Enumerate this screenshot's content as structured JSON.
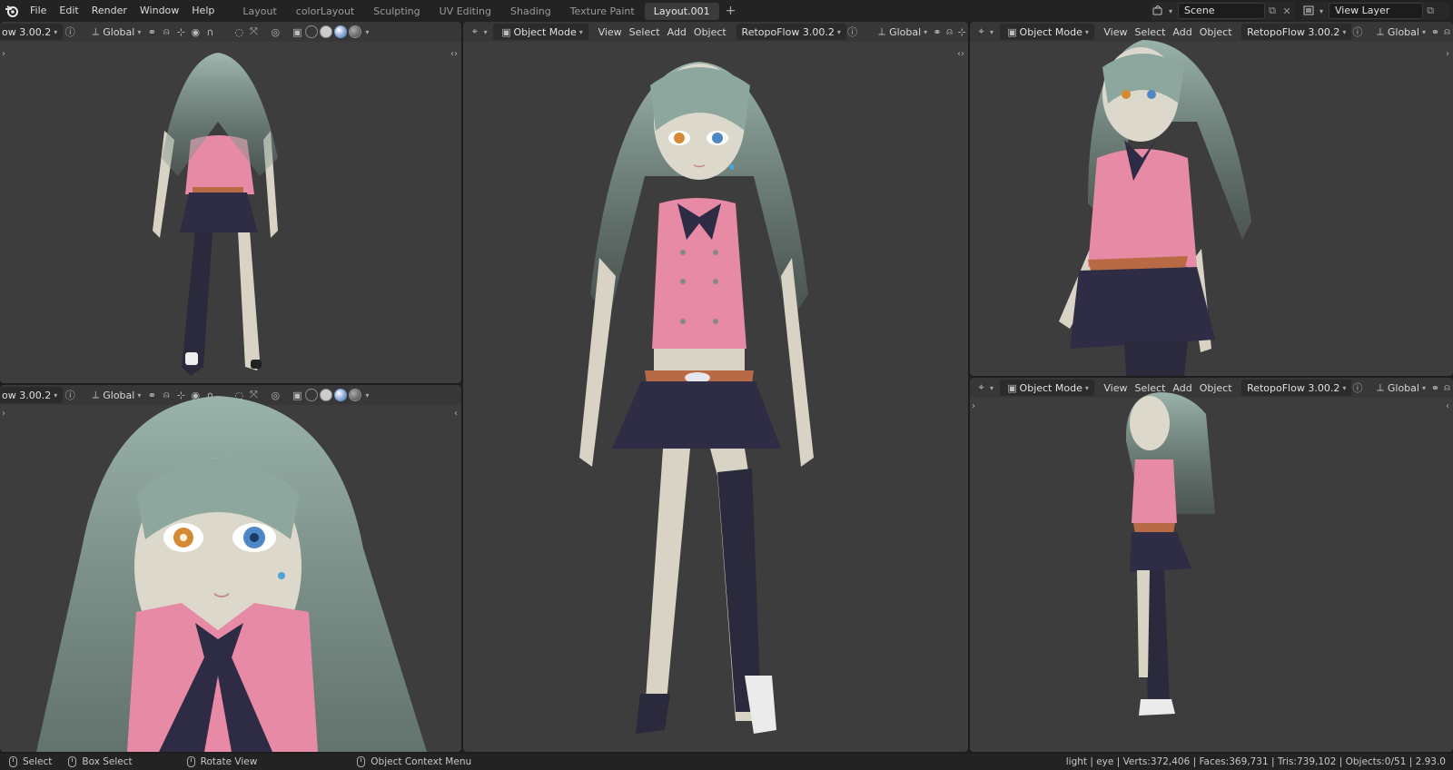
{
  "topbar": {
    "menu": [
      "File",
      "Edit",
      "Render",
      "Window",
      "Help"
    ],
    "workspaces": [
      "Layout",
      "colorLayout",
      "Sculpting",
      "UV Editing",
      "Shading",
      "Texture Paint",
      "Layout.001"
    ],
    "active_workspace": "Layout.001",
    "add_label": "+",
    "scene_name": "Scene",
    "view_layer_name": "View Layer"
  },
  "viewports": {
    "top_left": {
      "flow_label": "ow 3.00.2",
      "orientation": "Global"
    },
    "bottom_left": {
      "flow_label": "ow 3.00.2",
      "orientation": "Global"
    },
    "center": {
      "mode": "Object Mode",
      "menus": [
        "View",
        "Select",
        "Add",
        "Object"
      ],
      "flow_label": "RetopoFlow 3.00.2",
      "orientation": "Global"
    },
    "top_right": {
      "mode": "Object Mode",
      "menus": [
        "View",
        "Select",
        "Add",
        "Object"
      ],
      "flow_label": "RetopoFlow 3.00.2",
      "orientation": "Global"
    },
    "bottom_right": {
      "mode": "Object Mode",
      "menus": [
        "View",
        "Select",
        "Add",
        "Object"
      ],
      "flow_label": "RetopoFlow 3.00.2",
      "orientation": "Global"
    }
  },
  "statusbar": {
    "select": "Select",
    "box_select": "Box Select",
    "rotate_view": "Rotate View",
    "context_menu": "Object Context Menu",
    "stats": "light | eye | Verts:372,406 | Faces:369,731 | Tris:739,102 | Objects:0/51 | 2.93.0"
  },
  "icons": {
    "blender_logo": "blender-logo-icon",
    "help": "help-icon",
    "snap": "magnet-icon",
    "overlay": "overlay-icon",
    "xray": "xray-icon",
    "shading_wire": "wireframe-icon",
    "shading_solid": "solid-icon",
    "shading_material": "material-icon",
    "shading_rendered": "rendered-icon"
  },
  "colors": {
    "viewport_bg": "#3d3d3d",
    "hair": "#8fa9a0",
    "top": "#e78aa5",
    "skirt": "#2f2d45",
    "skin": "#d9d4c6",
    "stocking": "#2b2a3d",
    "belt": "#b86a45",
    "active_tab": "#3b3b3b"
  }
}
